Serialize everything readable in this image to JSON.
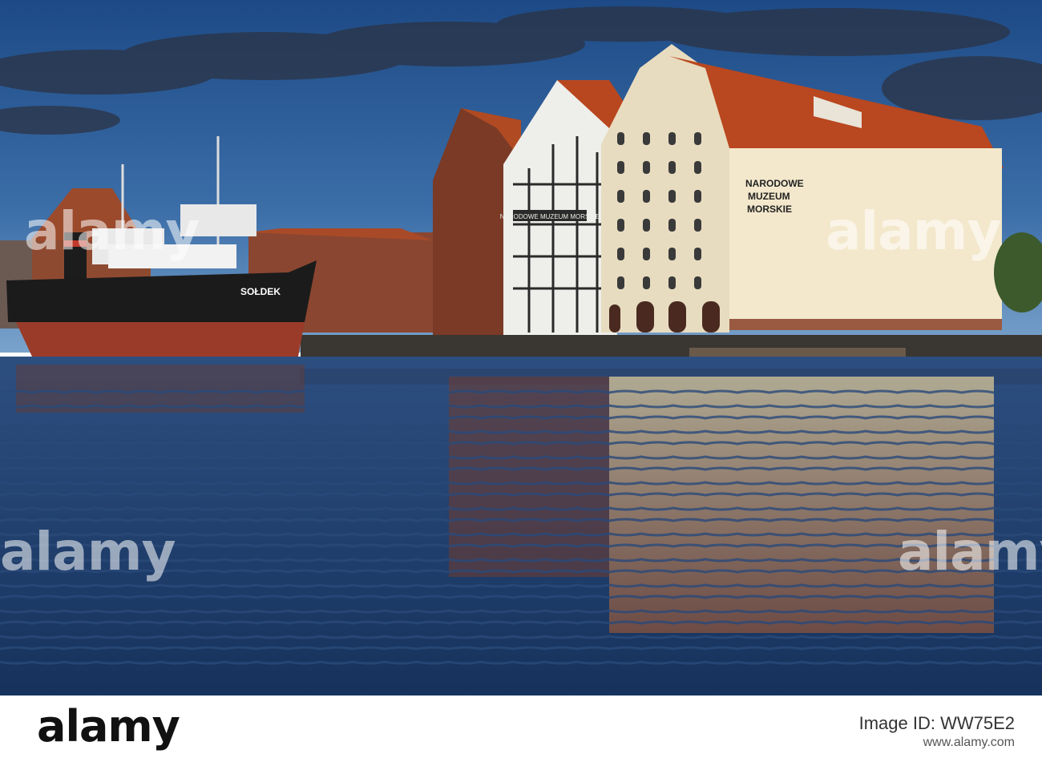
{
  "scene": {
    "ship_name": "SOŁDEK",
    "museum_sign": [
      "NARODOWE",
      "MUZEUM",
      "MORSKIE"
    ],
    "facade_sign": "NARODOWE MUZEUM MORSKIE",
    "colors": {
      "sky_top": "#1f4f8c",
      "sky_bottom": "#6f9cc8",
      "water": "#1e3f6e",
      "roof": "#b8471f",
      "museum_wall": "#efe3c8",
      "ship_hull_red": "#9a3b2a",
      "ship_hull_black": "#1b1b1b"
    }
  },
  "watermarks": [
    "alamy",
    "alamy",
    "alamy",
    "alamy"
  ],
  "footer": {
    "logo": "alamy",
    "image_id": "Image ID: WW75E2",
    "url": "www.alamy.com"
  }
}
